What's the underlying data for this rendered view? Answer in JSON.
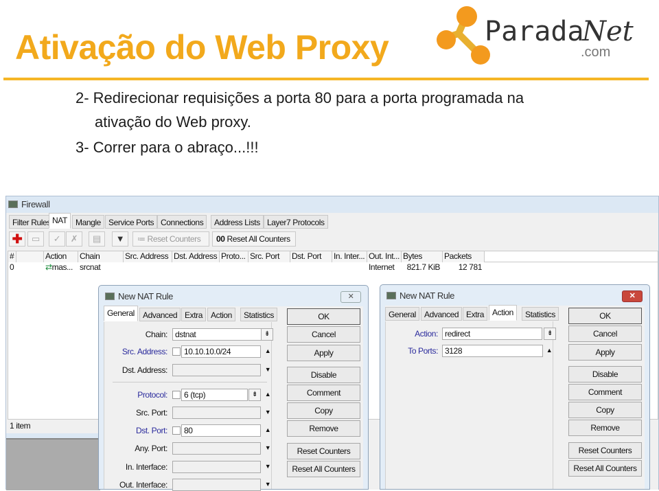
{
  "slide": {
    "title": "Ativação do Web Proxy",
    "lines": [
      "2- Redirecionar requisições a porta 80 para a porta programada na",
      "ativação do Web proxy.",
      "3- Correr para o abraço...!!!"
    ],
    "logo_text": "ParadaNet .com",
    "accent": "#f2a91c"
  },
  "firewall": {
    "title": "Firewall",
    "tabs": [
      "Filter Rules",
      "NAT",
      "Mangle",
      "Service Ports",
      "Connections",
      "Address Lists",
      "Layer7 Protocols"
    ],
    "selected_tab": "NAT",
    "toolbar": {
      "reset_counters": "Reset Counters",
      "reset_all_counters": "Reset All Counters",
      "reset_all_prefix": "00"
    },
    "columns": [
      "#",
      "",
      "Action",
      "Chain",
      "Src. Address",
      "Dst. Address",
      "Proto...",
      "Src. Port",
      "Dst. Port",
      "In. Inter...",
      "Out. Int...",
      "Bytes",
      "Packets"
    ],
    "rows": [
      [
        "0",
        "",
        "mas...",
        "srcnat",
        "",
        "",
        "",
        "",
        "",
        "",
        "Internet",
        "821.7 KiB",
        "12 781"
      ]
    ],
    "status": "1 item"
  },
  "dialog1": {
    "title": "New NAT Rule",
    "tabs": [
      "General",
      "Advanced",
      "Extra",
      "Action",
      "Statistics"
    ],
    "selected_tab": "General",
    "fields": [
      {
        "label": "Chain:",
        "value": "dstnat",
        "blue": false
      },
      {
        "label": "Src. Address:",
        "value": "10.10.10.0/24",
        "blue": true
      },
      {
        "label": "Dst. Address:",
        "value": "",
        "blue": false
      },
      {
        "label": "Protocol:",
        "value": "6 (tcp)",
        "blue": true
      },
      {
        "label": "Src. Port:",
        "value": "",
        "blue": false
      },
      {
        "label": "Dst. Port:",
        "value": "80",
        "blue": true
      },
      {
        "label": "Any. Port:",
        "value": "",
        "blue": false
      },
      {
        "label": "In. Interface:",
        "value": "",
        "blue": false
      },
      {
        "label": "Out. Interface:",
        "value": "",
        "blue": false
      }
    ],
    "buttons": [
      "OK",
      "Cancel",
      "Apply",
      "Disable",
      "Comment",
      "Copy",
      "Remove",
      "Reset Counters",
      "Reset All Counters"
    ]
  },
  "dialog2": {
    "title": "New NAT Rule",
    "tabs": [
      "General",
      "Advanced",
      "Extra",
      "Action",
      "Statistics"
    ],
    "selected_tab": "Action",
    "fields": [
      {
        "label": "Action:",
        "value": "redirect",
        "blue": true
      },
      {
        "label": "To Ports:",
        "value": "3128",
        "blue": true
      }
    ],
    "buttons": [
      "OK",
      "Cancel",
      "Apply",
      "Disable",
      "Comment",
      "Copy",
      "Remove",
      "Reset Counters",
      "Reset All Counters"
    ]
  }
}
